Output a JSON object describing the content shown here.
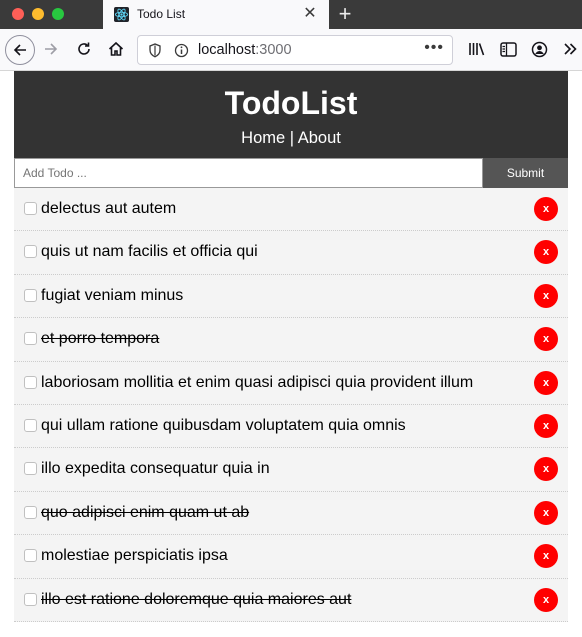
{
  "browser": {
    "tab_title": "Todo List",
    "tab_close": "✕",
    "new_tab": "+",
    "url_host": "localhost",
    "url_port": ":3000",
    "url_menu": "•••"
  },
  "app": {
    "title": "TodoList",
    "nav": {
      "home": "Home",
      "separator": " | ",
      "about": "About"
    },
    "form": {
      "placeholder": "Add Todo ...",
      "submit_label": "Submit"
    },
    "delete_label": "x",
    "todos": [
      {
        "title": "delectus aut autem",
        "completed": false
      },
      {
        "title": "quis ut nam facilis et officia qui",
        "completed": false
      },
      {
        "title": "fugiat veniam minus",
        "completed": false
      },
      {
        "title": "et porro tempora",
        "completed": true
      },
      {
        "title": "laboriosam mollitia et enim quasi adipisci quia provident illum",
        "completed": false
      },
      {
        "title": "qui ullam ratione quibusdam voluptatem quia omnis",
        "completed": false
      },
      {
        "title": "illo expedita consequatur quia in",
        "completed": false
      },
      {
        "title": "quo adipisci enim quam ut ab",
        "completed": true
      },
      {
        "title": "molestiae perspiciatis ipsa",
        "completed": false
      },
      {
        "title": "illo est ratione doloremque quia maiores aut",
        "completed": true
      }
    ]
  },
  "colors": {
    "header_bg": "#333333",
    "delete_button": "#ff0000",
    "submit_button": "#555555",
    "item_bg": "#f4f4f4"
  }
}
